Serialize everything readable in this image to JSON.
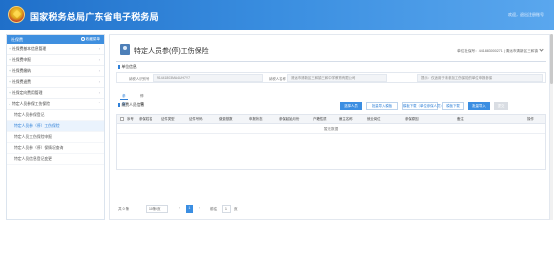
{
  "header": {
    "title": "国家税务总局广东省电子税务局",
    "user_text": "欢迎，退出注册账号"
  },
  "sidebar": {
    "title": "社保费",
    "fav_label": "收藏菜单",
    "items": [
      {
        "label": "社保费基本信息管理"
      },
      {
        "label": "社保费申报"
      },
      {
        "label": "社保费缴纳"
      },
      {
        "label": "社保费退费"
      },
      {
        "label": "社保定向费用管理"
      },
      {
        "label": "特定人员参保工伤保险"
      }
    ],
    "subitems": [
      {
        "label": "特定人员参保登记"
      },
      {
        "label": "特定人员参（停）工伤保险"
      },
      {
        "label": "特定人员工伤保险申报"
      },
      {
        "label": "特定人员参（停）保情况查询"
      },
      {
        "label": "特定人员信息登记变更"
      }
    ]
  },
  "main": {
    "title": "特定人员参(停)工伤保险",
    "unit_label": "单位社保号：",
    "unit_value": "441883000271 | 清远市清新区三和镇",
    "section_unit": "单位信息",
    "form": {
      "code_label": "纳税人识别号",
      "code_value": "91441803MA4UH7Y7",
      "name_label": "纳税人名称",
      "name_value": "清远市清新区三和镇三和中学教育有限公司",
      "tip_text": "提示：仅适用于未参加工伤保险的单位申报参保"
    },
    "tabs": [
      {
        "label": "参保"
      },
      {
        "label": "停保"
      }
    ],
    "section_list": "缴费人员信息",
    "buttons": {
      "select": "选择人员",
      "batch_import": "批量导入模板",
      "download": "模板下载（单位参保人员）",
      "template": "模板下载",
      "import": "批量导入",
      "submit": "提交"
    },
    "table_headers": [
      "序号",
      "参保姓名",
      "证件类型",
      "证件号码",
      "缴费基数",
      "申报状态",
      "参保起始月份",
      "户籍性质",
      "雇主名称",
      "就业岗位",
      "参保原因",
      "备注",
      "操作"
    ],
    "empty_text": "暂无数据",
    "pager": {
      "total": "共 0 条",
      "page_size": "10条/页",
      "current": "1",
      "goto_label": "前往",
      "goto_value": "1",
      "page_suffix": "页"
    }
  }
}
